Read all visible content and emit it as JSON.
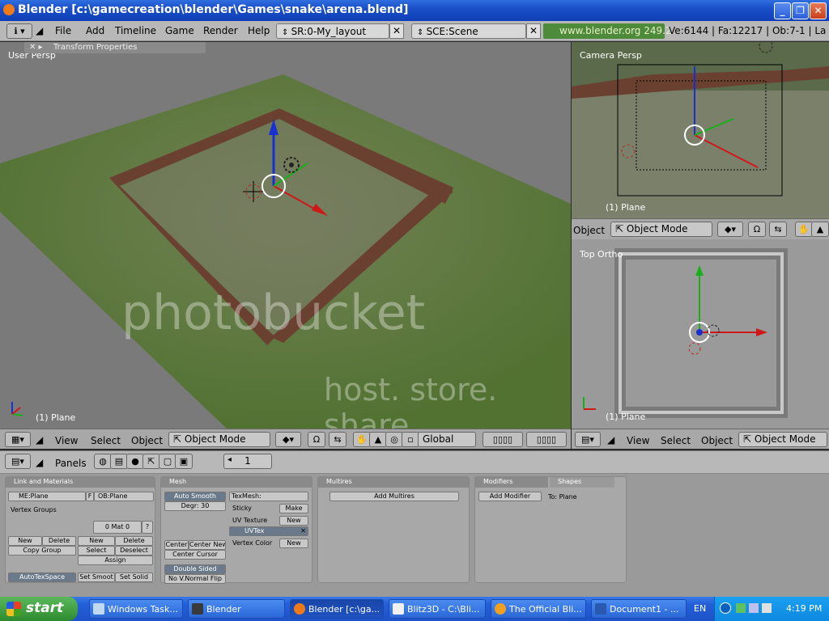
{
  "window": {
    "title": "Blender [c:\\gamecreation\\blender\\Games\\snake\\arena.blend]",
    "min": "_",
    "max": "❐",
    "close": "✕"
  },
  "menu": {
    "items": [
      "File",
      "Add",
      "Timeline",
      "Game",
      "Render",
      "Help"
    ]
  },
  "screen_field": "SR:0-My_layout",
  "scene_field": "SCE:Scene",
  "url": "www.blender.org 249.2",
  "stats": "Ve:6144 | Fa:12217 | Ob:7-1 | La",
  "viewports": {
    "main": {
      "label": "User Persp",
      "obj": "(1) Plane",
      "transform_tab": "Transform Properties"
    },
    "cam": {
      "label": "Camera Persp",
      "obj": "(1) Plane"
    },
    "top": {
      "label": "Top Ortho",
      "obj": "(1) Plane"
    }
  },
  "main_header": {
    "view": "View",
    "select": "Select",
    "object": "Object",
    "mode": "Object Mode",
    "orient": "Global"
  },
  "cam_header": {
    "object": "Object",
    "mode": "Object Mode"
  },
  "top_header": {
    "view": "View",
    "select": "Select",
    "object": "Object",
    "mode": "Object Mode"
  },
  "buttons_header": {
    "panels": "Panels",
    "frame": "1"
  },
  "panels": {
    "link": {
      "title": "Link and Materials",
      "me": "ME:Plane",
      "f": "F",
      "ob": "OB:Plane",
      "vgroups": "Vertex Groups",
      "mat": "0 Mat 0",
      "q": "?",
      "new1": "New",
      "delete1": "Delete",
      "copygroup": "Copy Group",
      "new2": "New",
      "delete2": "Delete",
      "select": "Select",
      "deselect": "Deselect",
      "assign": "Assign",
      "autotex": "AutoTexSpace",
      "setsmooth": "Set Smoot",
      "setsolid": "Set Solid"
    },
    "mesh": {
      "title": "Mesh",
      "autosmooth": "Auto Smooth",
      "degr": "Degr: 30",
      "texmesh": "TexMesh:",
      "sticky": "Sticky",
      "make": "Make",
      "uvtex": "UV Texture",
      "new1": "New",
      "uvtex_name": "UVTex",
      "vcol": "Vertex Color",
      "new2": "New",
      "centernew": "Center New",
      "center": "Center",
      "centercursor": "Center Cursor",
      "doublesided": "Double Sided",
      "nonormal": "No V.Normal Flip"
    },
    "multires": {
      "title": "Multires",
      "add": "Add Multires"
    },
    "modifiers": {
      "title": "Modifiers",
      "shapes": "Shapes",
      "add": "Add Modifier",
      "to": "To: Plane"
    }
  },
  "taskbar": {
    "start": "start",
    "tasks": [
      "Windows Task...",
      "Blender",
      "Blender [c:\\ga...",
      "Blitz3D - C:\\Bli...",
      "The Official Bli...",
      "Document1 - ..."
    ],
    "lang": "EN",
    "time": "4:19 PM"
  },
  "watermark": {
    "line1": "photobucket",
    "line2": "host. store. share."
  },
  "colors": {
    "titlebar": "#1a4fc8",
    "grass": "#5a7a3a",
    "fence": "#6a4030",
    "x_axis": "#d01818",
    "y_axis": "#18b018",
    "z_axis": "#1830d0"
  }
}
